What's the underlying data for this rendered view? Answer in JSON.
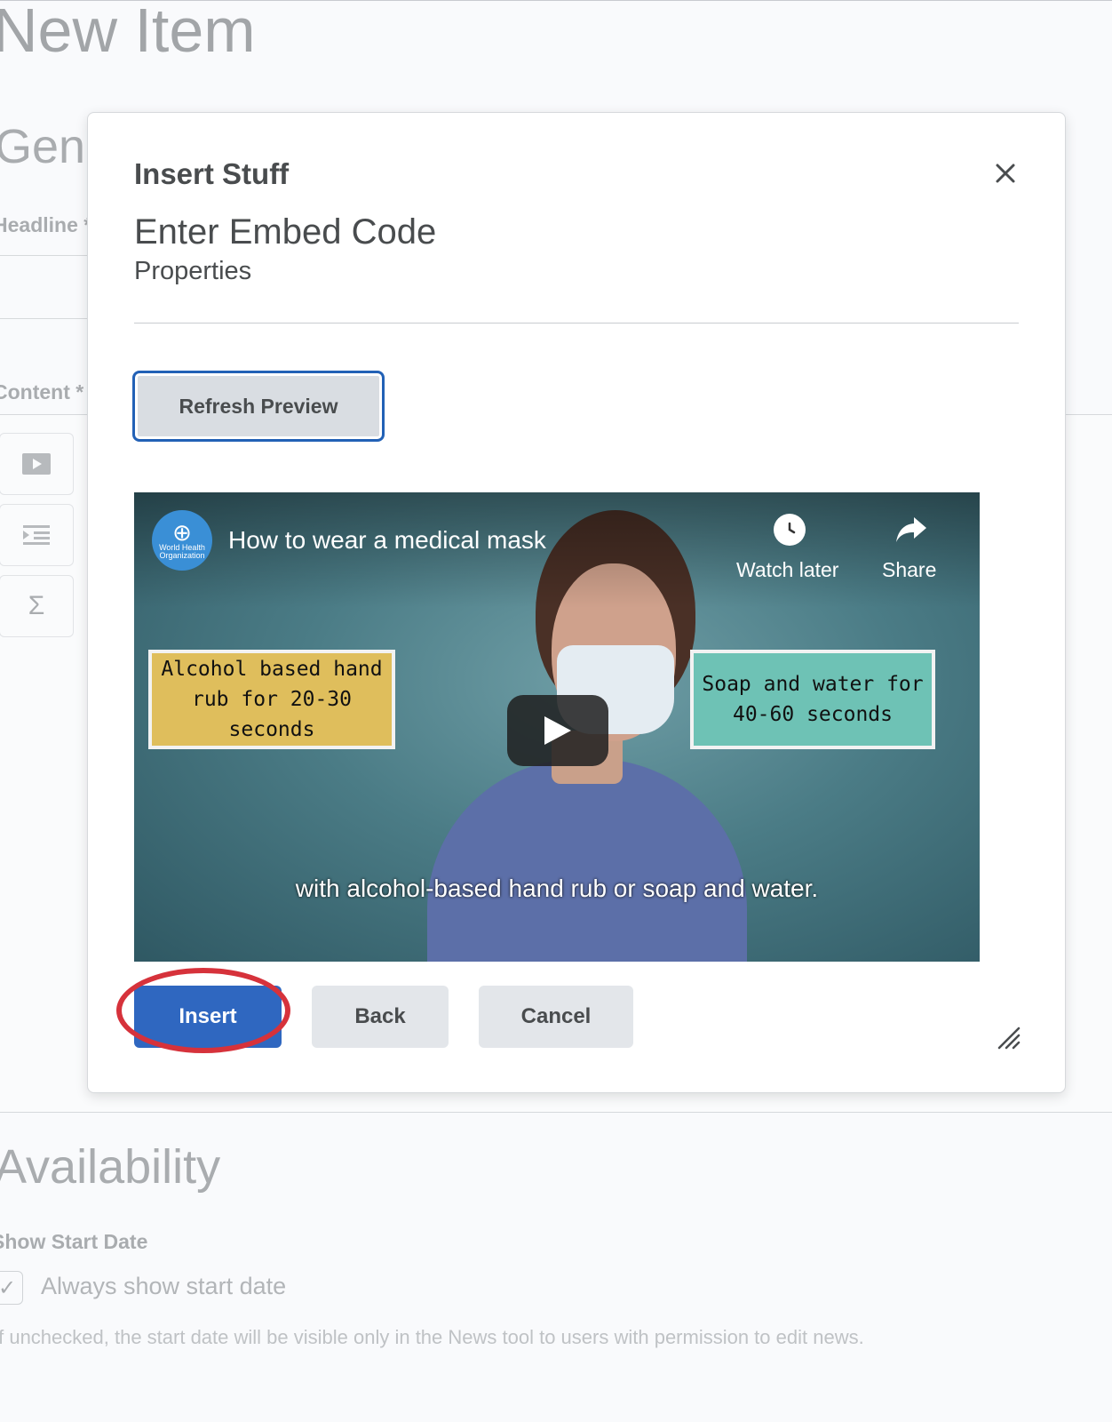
{
  "background": {
    "page_title": "New Item",
    "section_general": "Gene",
    "headline_label": "Headline *",
    "content_label": "Content *",
    "section_availability": "Availability",
    "show_start_date_label": "Show Start Date",
    "always_show_label": "Always show start date",
    "always_show_checked": true,
    "help_text": "If unchecked, the start date will be visible only in the News tool to users with permission to edit news.",
    "toolbar_icons": [
      "video-icon",
      "indent-icon",
      "sigma-icon"
    ]
  },
  "modal": {
    "title": "Insert Stuff",
    "step_title": "Enter Embed Code",
    "step_subtitle": "Properties",
    "refresh_label": "Refresh Preview",
    "video": {
      "channel": "World Health Organization",
      "title": "How to wear a medical mask",
      "watch_later": "Watch later",
      "share": "Share",
      "callout_left": "Alcohol based hand rub for 20-30 seconds",
      "callout_right": "Soap and water for 40-60 seconds",
      "caption": "with alcohol-based hand rub or soap and water."
    },
    "buttons": {
      "insert": "Insert",
      "back": "Back",
      "cancel": "Cancel"
    },
    "colors": {
      "primary": "#2f67c0",
      "highlight": "#d6323b",
      "focus_ring": "#2261b6"
    }
  }
}
